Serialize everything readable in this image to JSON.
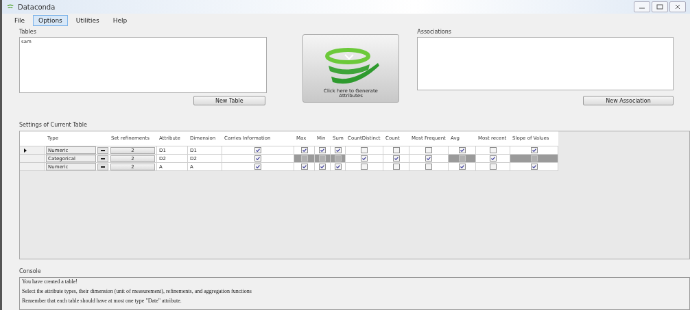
{
  "window": {
    "title": "Dataconda"
  },
  "menu": [
    {
      "label": "File",
      "selected": false
    },
    {
      "label": "Options",
      "selected": true
    },
    {
      "label": "Utilities",
      "selected": false
    },
    {
      "label": "Help",
      "selected": false
    }
  ],
  "tables": {
    "label": "Tables",
    "items": [
      {
        "label": "sam",
        "selected": false
      }
    ],
    "button": "New Table"
  },
  "generate_button": {
    "label": "Click here to Generate Attributes"
  },
  "associations": {
    "label": "Associations",
    "button": "New Association"
  },
  "settings": {
    "label": "Settings of Current Table",
    "columns": [
      "Type",
      "Set refinements",
      "Attribute",
      "Dimension",
      "Carries Information",
      "Max",
      "Min",
      "Sum",
      "CountDistinct",
      "Count",
      "Most Frequent",
      "Avg",
      "Most recent",
      "Slope of Values"
    ],
    "rows": [
      {
        "current": true,
        "type": "Numeric",
        "refinements": "2",
        "attribute": "D1",
        "dimension": "D1",
        "checks": [
          {
            "checked": true,
            "disabled": false
          },
          {
            "checked": true,
            "disabled": false
          },
          {
            "checked": true,
            "disabled": false
          },
          {
            "checked": true,
            "disabled": false
          },
          {
            "checked": false,
            "disabled": false
          },
          {
            "checked": false,
            "disabled": false
          },
          {
            "checked": false,
            "disabled": false
          },
          {
            "checked": true,
            "disabled": false
          },
          {
            "checked": false,
            "disabled": false
          },
          {
            "checked": true,
            "disabled": false
          }
        ]
      },
      {
        "current": false,
        "type": "Categorical",
        "refinements": "2",
        "attribute": "D2",
        "dimension": "D2",
        "checks": [
          {
            "checked": true,
            "disabled": false
          },
          {
            "checked": false,
            "disabled": true
          },
          {
            "checked": false,
            "disabled": true
          },
          {
            "checked": false,
            "disabled": true
          },
          {
            "checked": true,
            "disabled": false
          },
          {
            "checked": true,
            "disabled": false
          },
          {
            "checked": true,
            "disabled": false
          },
          {
            "checked": false,
            "disabled": true
          },
          {
            "checked": true,
            "disabled": false
          },
          {
            "checked": false,
            "disabled": true
          }
        ]
      },
      {
        "current": false,
        "type": "Numeric",
        "refinements": "2",
        "attribute": "A",
        "dimension": "A",
        "checks": [
          {
            "checked": true,
            "disabled": false
          },
          {
            "checked": true,
            "disabled": false
          },
          {
            "checked": true,
            "disabled": false
          },
          {
            "checked": true,
            "disabled": false
          },
          {
            "checked": false,
            "disabled": false
          },
          {
            "checked": false,
            "disabled": false
          },
          {
            "checked": false,
            "disabled": false
          },
          {
            "checked": true,
            "disabled": false
          },
          {
            "checked": false,
            "disabled": false
          },
          {
            "checked": true,
            "disabled": false
          }
        ]
      }
    ]
  },
  "console": {
    "label": "Console",
    "lines": [
      "You have created a table!",
      "Select the attribute types, their dimension (unit of measurement), refinements, and aggregation functions",
      "Remember that each table should have at most one type \"Date\" attribute."
    ]
  }
}
